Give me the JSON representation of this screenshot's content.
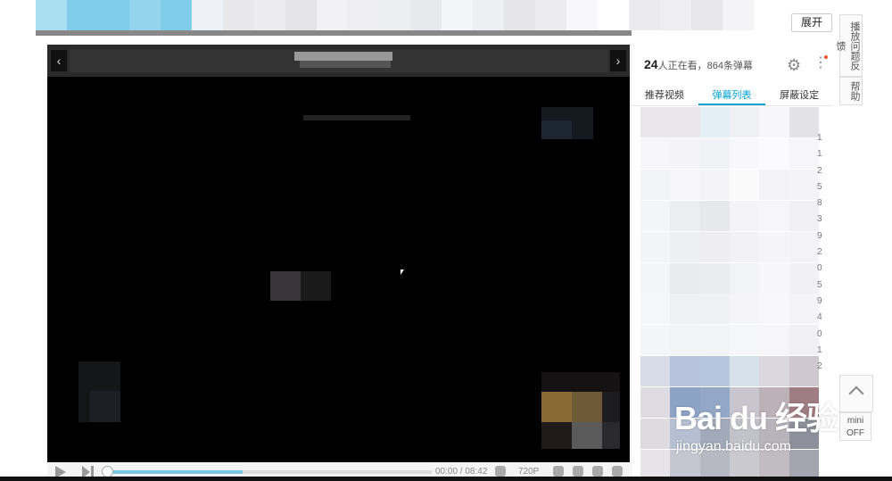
{
  "header": {
    "expand_label": "展开"
  },
  "player": {
    "prev_arrow": "‹",
    "next_arrow": "›",
    "time": "00:00 / 08:42",
    "quality": "720P",
    "progress_fraction": 0.42
  },
  "panel": {
    "viewers_count": "24",
    "viewers_text": "人正在看，864条弹幕",
    "tabs": [
      {
        "label": "推荐视频"
      },
      {
        "label": "弹幕列表"
      },
      {
        "label": "屏蔽设定"
      }
    ],
    "list_digits": [
      "1",
      "1",
      "2",
      "5",
      "8",
      "3",
      "9",
      "2",
      "0",
      "5",
      "9",
      "4",
      "0",
      "1",
      "2"
    ]
  },
  "side": {
    "report_label": "播放问题反馈",
    "help_label": "帮助",
    "mini_label": "mini",
    "mini_state": "OFF"
  },
  "watermark": {
    "logo": "Bai du 经验",
    "url": "jingyan.baidu.com"
  },
  "colors": {
    "accent": "#00a1d6",
    "player_bg": "#000000"
  }
}
